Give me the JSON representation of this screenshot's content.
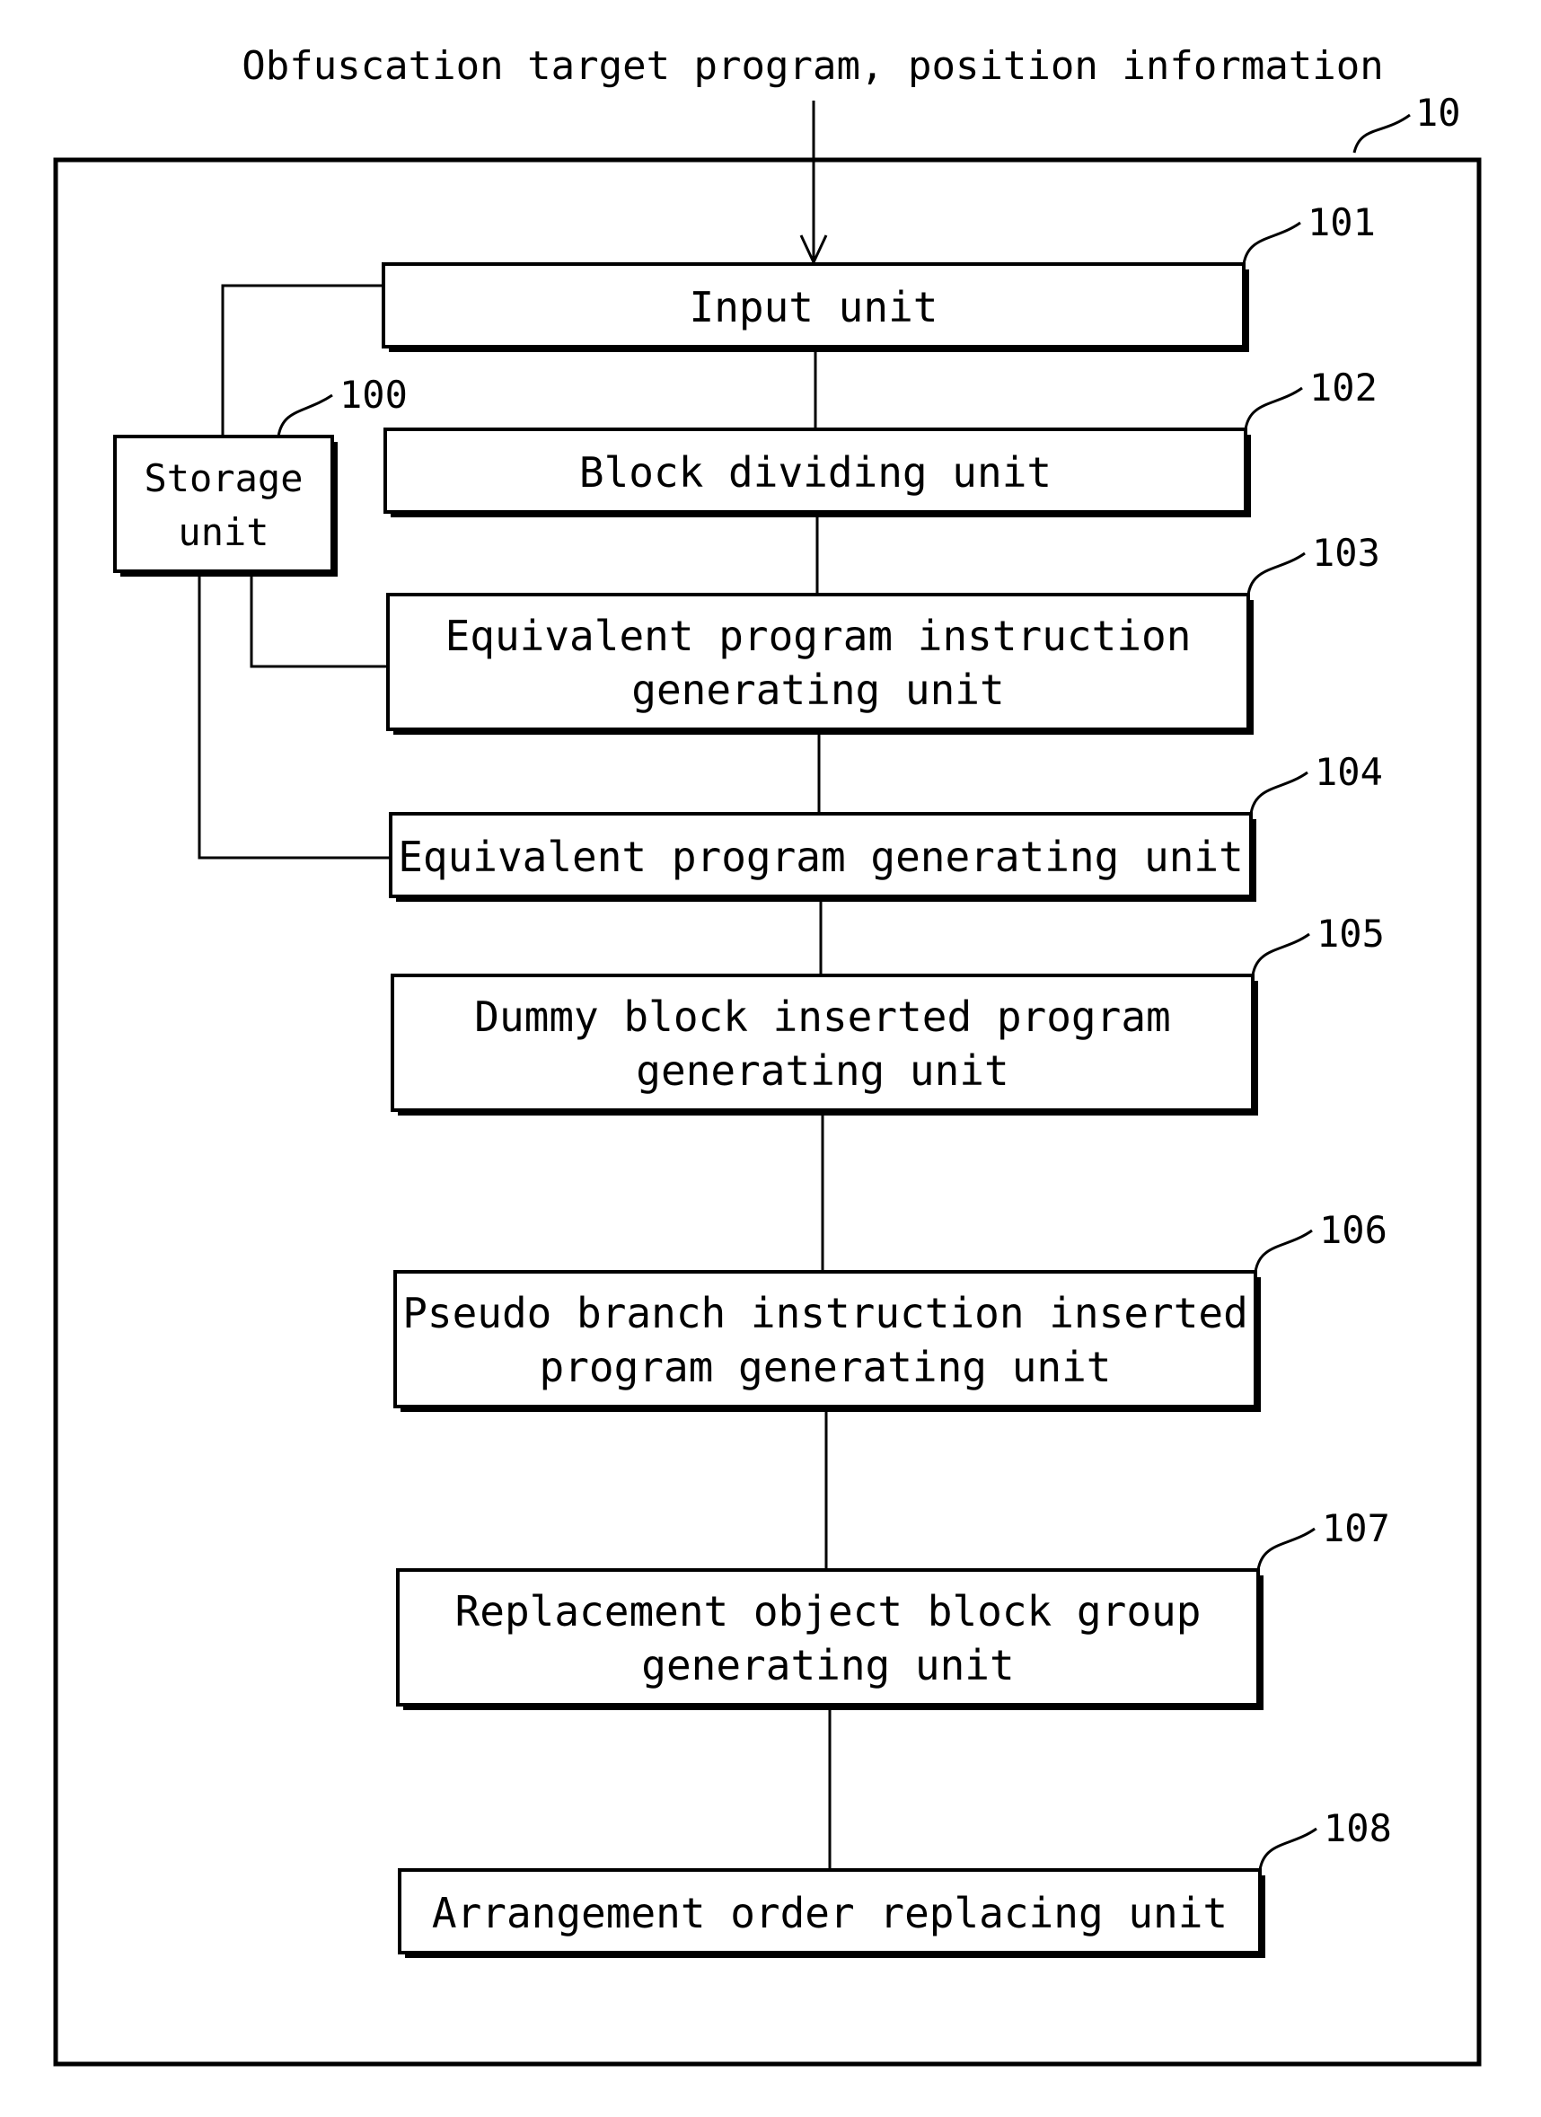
{
  "diagram": {
    "input_label": "Obfuscation target program, position information",
    "device": {
      "ref": "10"
    },
    "storage": {
      "ref": "100",
      "lines": [
        "Storage",
        "unit"
      ]
    },
    "units": [
      {
        "ref": "101",
        "lines": [
          "Input unit"
        ]
      },
      {
        "ref": "102",
        "lines": [
          "Block dividing unit"
        ]
      },
      {
        "ref": "103",
        "lines": [
          "Equivalent program instruction",
          "generating unit"
        ]
      },
      {
        "ref": "104",
        "lines": [
          "Equivalent program generating unit"
        ]
      },
      {
        "ref": "105",
        "lines": [
          "Dummy block inserted program",
          "generating unit"
        ]
      },
      {
        "ref": "106",
        "lines": [
          "Pseudo branch instruction inserted",
          "program generating unit"
        ]
      },
      {
        "ref": "107",
        "lines": [
          "Replacement object block group",
          "generating unit"
        ]
      },
      {
        "ref": "108",
        "lines": [
          "Arrangement order replacing unit"
        ]
      }
    ]
  }
}
